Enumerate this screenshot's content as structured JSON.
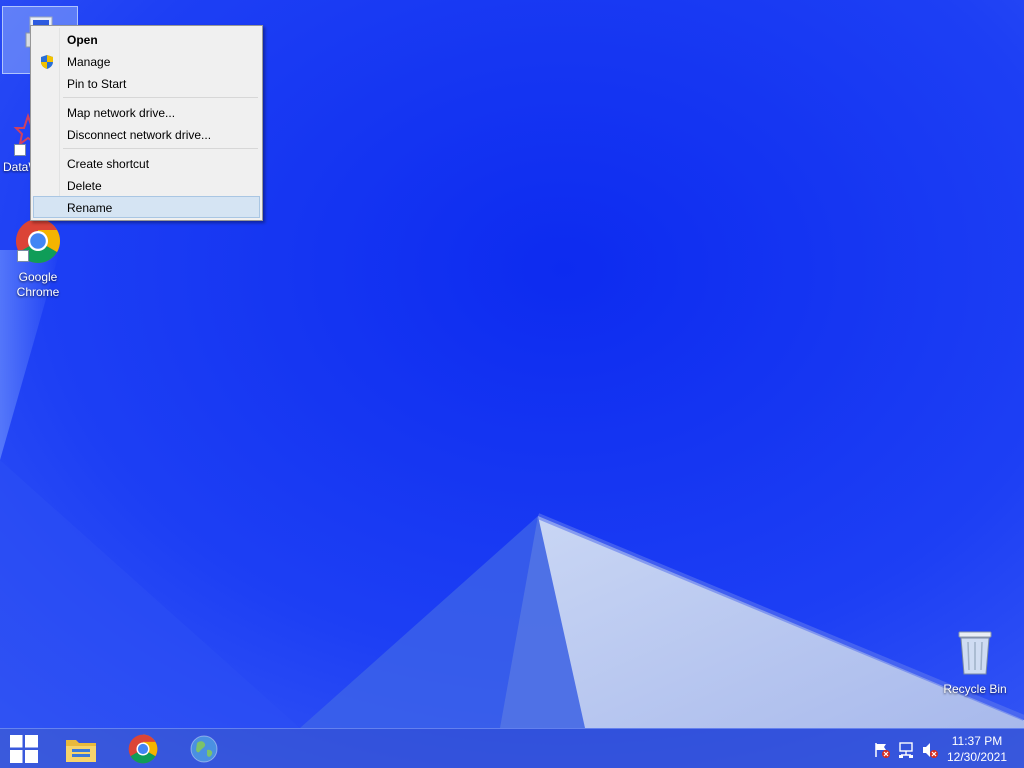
{
  "desktop": {
    "icons": [
      {
        "label": "DataW"
      },
      {
        "label": "Google Chrome"
      },
      {
        "label": "Recycle Bin"
      }
    ]
  },
  "context_menu": {
    "items": [
      {
        "label": "Open",
        "bold": true
      },
      {
        "label": "Manage",
        "icon": "uac-shield-icon"
      },
      {
        "label": "Pin to Start"
      },
      {
        "label": "Map network drive..."
      },
      {
        "label": "Disconnect network drive..."
      },
      {
        "label": "Create shortcut"
      },
      {
        "label": "Delete"
      },
      {
        "label": "Rename",
        "highlighted": true
      }
    ]
  },
  "taskbar": {
    "buttons": [
      "start-button",
      "file-explorer-button",
      "chrome-button",
      "internet-explorer-button"
    ],
    "tray_icons": [
      "action-center-flag-icon",
      "network-icon",
      "volume-muted-icon"
    ],
    "clock": {
      "time": "11:37 PM",
      "date": "12/30/2021"
    }
  },
  "colors": {
    "wallpaper": "#1f3ff2",
    "menu_background": "#f0f0f0",
    "menu_highlight": "#d5e4f3"
  }
}
